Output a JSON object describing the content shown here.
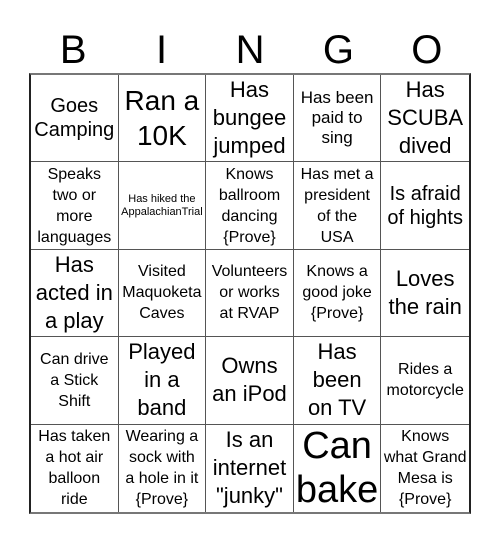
{
  "header": [
    "B",
    "I",
    "N",
    "G",
    "O"
  ],
  "cells": [
    {
      "text": "Goes\nCamping",
      "size": "s20"
    },
    {
      "text": "Ran a\n10K",
      "size": "s28"
    },
    {
      "text": "Has\nbungee\njumped",
      "size": "s22"
    },
    {
      "text": "Has been\npaid to\nsing",
      "size": "s17"
    },
    {
      "text": "Has\nSCUBA\ndived",
      "size": "s22"
    },
    {
      "text": "Speaks\ntwo or\nmore\nlanguages",
      "size": "s16"
    },
    {
      "text": "Has hiked the\nAppalachianTrial",
      "size": "s11"
    },
    {
      "text": "Knows\nballroom\ndancing\n{Prove}",
      "size": "s16"
    },
    {
      "text": "Has met a\npresident\nof the\nUSA",
      "size": "s16"
    },
    {
      "text": "Is afraid\nof hights",
      "size": "s20"
    },
    {
      "text": "Has\nacted in\na play",
      "size": "s22"
    },
    {
      "text": "Visited\nMaquoketa\nCaves",
      "size": "s16"
    },
    {
      "text": "Volunteers\nor works\nat RVAP",
      "size": "s16"
    },
    {
      "text": "Knows a\ngood joke\n{Prove}",
      "size": "s16"
    },
    {
      "text": "Loves\nthe rain",
      "size": "s22"
    },
    {
      "text": "Can drive\na Stick\nShift",
      "size": "s16"
    },
    {
      "text": "Played\nin a\nband",
      "size": "s22"
    },
    {
      "text": "Owns\nan iPod",
      "size": "s22"
    },
    {
      "text": "Has\nbeen\non TV",
      "size": "s22"
    },
    {
      "text": "Rides a\nmotorcycle",
      "size": "s16"
    },
    {
      "text": "Has taken\na hot air\nballoon\nride",
      "size": "s16"
    },
    {
      "text": "Wearing a\nsock with\na hole in it\n{Prove}",
      "size": "s16"
    },
    {
      "text": "Is an\ninternet\n\"junky\"",
      "size": "s22"
    },
    {
      "text": "Can\nbake",
      "size": "s38"
    },
    {
      "text": "Knows\nwhat Grand\nMesa is\n{Prove}",
      "size": "s16"
    }
  ]
}
